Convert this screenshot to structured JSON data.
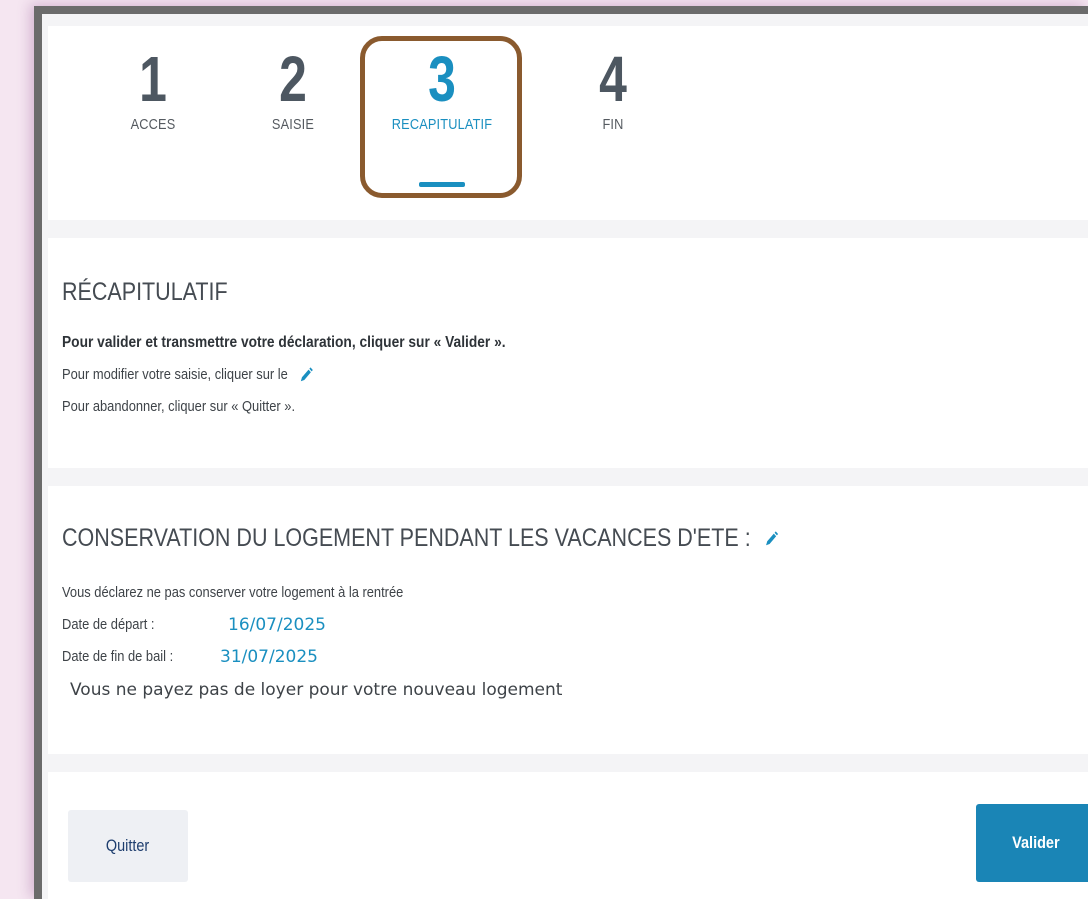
{
  "steps": [
    {
      "num": "1",
      "label": "ACCES"
    },
    {
      "num": "2",
      "label": "SAISIE"
    },
    {
      "num": "3",
      "label": "RECAPITULATIF"
    },
    {
      "num": "4",
      "label": "FIN"
    }
  ],
  "active_step": 3,
  "colors": {
    "accent": "#1a8fc0",
    "highlight_border": "#8a5a2e",
    "text": "#3e4348"
  },
  "recap": {
    "title": "RÉCAPITULATIF",
    "line_validate": "Pour valider et transmettre votre déclaration, cliquer sur « Valider ».",
    "line_modify": "Pour modifier votre saisie, cliquer sur le",
    "line_quit": "Pour abandonner, cliquer sur « Quitter ».",
    "icon": "pencil-icon"
  },
  "conservation": {
    "title": "CONSERVATION DU LOGEMENT PENDANT LES VACANCES D'ETE :",
    "icon": "pencil-icon",
    "declare_text": "Vous déclarez ne pas conserver votre logement à la rentrée",
    "depart_label": "Date de départ :",
    "depart_value": "16/07/2025",
    "fin_bail_label": "Date de fin de bail :",
    "fin_bail_value": "31/07/2025",
    "loyer_text": "Vous ne payez pas de loyer pour votre nouveau logement"
  },
  "actions": {
    "quit_label": "Quitter",
    "validate_label": "Valider"
  }
}
